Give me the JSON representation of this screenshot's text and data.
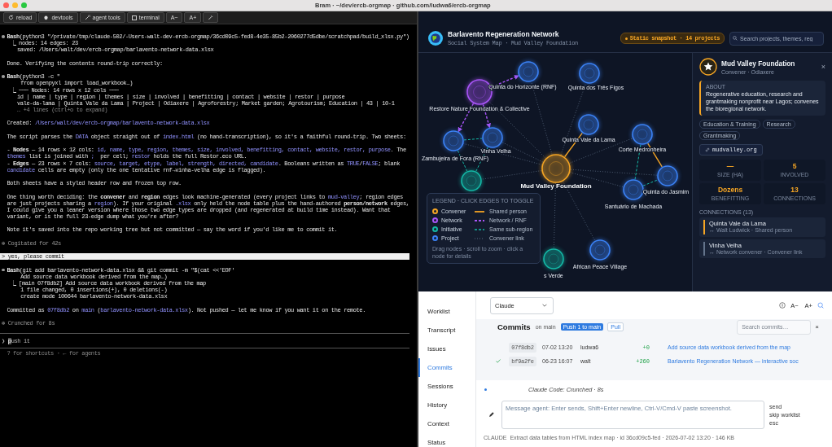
{
  "window": {
    "title": "Bram · ~/dev/ercb-orgmap · github.com/ludwa6/ercb-orgmap"
  },
  "toolbar": [
    {
      "kind": "button",
      "label": "reload"
    },
    {
      "kind": "button",
      "label": "devtools"
    },
    {
      "kind": "button",
      "label": "agent tools"
    },
    {
      "kind": "toggle",
      "label": "terminal",
      "checked": false
    },
    {
      "kind": "button",
      "label": "A−"
    },
    {
      "kind": "button",
      "label": "A+"
    }
  ],
  "terminal": {
    "blocks": [
      {
        "lines": [
          {
            "kind": "tool",
            "parts": [
              {
                "text": "Bash",
                "kind": "bold"
              },
              "(python3 \"/private/tmp/claude-502/-Users-walt-dev-ercb-orgmap/36cd09c5-fed8-4e35-85b2-2060277d5dbe/scratchpad/build_xlsx.py\")"
            ]
          },
          {
            "kind": "result",
            "parts": [
              "⎿ nodes: 14 edges: 23"
            ]
          },
          {
            "kind": "cont",
            "parts": [
              "saved: /Users/walt/dev/ercb-orgmap/barlavento-network-data.xlsx"
            ]
          }
        ]
      },
      {
        "lines": [
          {
            "kind": "text",
            "parts": [
              "Done. Verifying the contents round-trip correctly:"
            ]
          }
        ]
      },
      {
        "lines": [
          {
            "kind": "tool",
            "parts": [
              {
                "text": "Bash",
                "kind": "bold"
              },
              "(python3 -c \""
            ]
          },
          {
            "kind": "arg",
            "parts": [
              "from openpyxl import load_workbook…)"
            ]
          },
          {
            "kind": "result",
            "parts": [
              "⎿ ─── Nodes: 14 rows x 12 cols ───"
            ]
          },
          {
            "kind": "cont",
            "parts": [
              "id | name | type | region | themes | size | involved | benefitting | contact | website | restor | purpose"
            ]
          },
          {
            "kind": "cont",
            "parts": [
              "vale-da-lama | Quinta Vale da Lama | Project | Odiaxere | Agroforestry; Market garden; Agrotourism; Education | 43 | 10-1"
            ]
          },
          {
            "kind": "dim",
            "parts": [
              "… +4 lines (ctrl+o to expand)"
            ]
          }
        ]
      },
      {
        "lines": [
          {
            "kind": "text",
            "parts": [
              "Created: ",
              {
                "text": "/Users/walt/dev/ercb-orgmap/barlavento-network-data.xlsx",
                "kind": "code"
              }
            ]
          }
        ]
      },
      {
        "lines": [
          {
            "kind": "text",
            "parts": [
              "The script parses the ",
              {
                "text": "DATA",
                "kind": "code"
              },
              " object straight out of ",
              {
                "text": "index.html",
                "kind": "code"
              },
              " (no hand-transcription), so it's a faithful round-trip. Two sheets:"
            ]
          }
        ]
      },
      {
        "lines": [
          {
            "kind": "text",
            "parts": [
              "- ",
              {
                "text": "Nodes",
                "kind": "bold"
              },
              " — 14 rows × 12 cols: ",
              {
                "text": "id, name, type, region, themes, size, involved, benefitting, contact, website, restor, purpose",
                "kind": "code"
              },
              ". The"
            ]
          },
          {
            "kind": "text",
            "parts": [
              {
                "text": "themes",
                "kind": "code"
              },
              " list is joined with ",
              {
                "text": ";",
                "kind": "code"
              },
              "  per cell; ",
              {
                "text": "restor",
                "kind": "code"
              },
              " holds the full Restor.eco URL."
            ]
          },
          {
            "kind": "text",
            "parts": [
              "- ",
              {
                "text": "Edges",
                "kind": "bold"
              },
              " — 23 rows × 7 cols: ",
              {
                "text": "source, target, etype, label, strength, directed, candidate",
                "kind": "code"
              },
              ". Booleans written as ",
              {
                "text": "TRUE",
                "kind": "code"
              },
              "/",
              {
                "text": "FALSE",
                "kind": "code"
              },
              "; blank"
            ]
          },
          {
            "kind": "text",
            "parts": [
              {
                "text": "candidate",
                "kind": "code"
              },
              " cells are empty (only the one tentative rnf→vinha-velha edge is flagged)."
            ]
          }
        ]
      },
      {
        "lines": [
          {
            "kind": "text",
            "parts": [
              "Both sheets have a styled header row and frozen top row."
            ]
          }
        ]
      },
      {
        "lines": [
          {
            "kind": "text",
            "parts": [
              "One thing worth deciding: the ",
              {
                "text": "convener",
                "kind": "bold"
              },
              " and ",
              {
                "text": "region",
                "kind": "bold"
              },
              " edges look machine-generated (every project links to ",
              {
                "text": "mud-valley",
                "kind": "code"
              },
              "; region edges"
            ]
          },
          {
            "kind": "text",
            "parts": [
              "are just projects sharing a ",
              {
                "text": "region",
                "kind": "code"
              },
              "). If your original ",
              {
                "text": ".xlsx",
                "kind": "code"
              },
              " only held the node table plus the hand-authored ",
              {
                "text": "person/network",
                "kind": "bold"
              },
              " edges,"
            ]
          },
          {
            "kind": "text",
            "parts": [
              "I could give you a leaner version where those two edge types are dropped (and regenerated at build time instead). Want that"
            ]
          },
          {
            "kind": "text",
            "parts": [
              "variant, or is the full 23-edge dump what you're after?"
            ]
          }
        ]
      },
      {
        "lines": [
          {
            "kind": "text",
            "parts": [
              "Note it's saved into the repo working tree but not committed — say the word if you'd like me to commit it."
            ]
          }
        ]
      },
      {
        "lines": [
          {
            "kind": "status",
            "parts": [
              "✻ Cogitated for 42s"
            ]
          }
        ]
      },
      {
        "lines": [
          {
            "kind": "prompt",
            "parts": [
              "> yes, please commit"
            ]
          }
        ]
      },
      {
        "lines": [
          {
            "kind": "tool",
            "parts": [
              {
                "text": "Bash",
                "kind": "bold"
              },
              "(git add barlavento-network-data.xlsx && git commit -m \"$(cat <<'EOF'"
            ]
          },
          {
            "kind": "arg",
            "parts": [
              "Add source data workbook derived from the map…)"
            ]
          },
          {
            "kind": "result",
            "parts": [
              "⎿ [main 07f8db2] Add source data workbook derived from the map"
            ]
          },
          {
            "kind": "arg",
            "parts": [
              "1 file changed, 0 insertions(+), 0 deletions(-)"
            ]
          },
          {
            "kind": "arg",
            "parts": [
              "create mode 100644 barlavento-network-data.xlsx"
            ]
          }
        ]
      },
      {
        "lines": [
          {
            "kind": "text",
            "parts": [
              "Committed as ",
              {
                "text": "07f8db2",
                "kind": "code"
              },
              " on ",
              {
                "text": "main",
                "kind": "code"
              },
              " (",
              {
                "text": "barlavento-network-data.xlsx",
                "kind": "code"
              },
              "). Not pushed — let me know if you want it on the remote."
            ]
          }
        ]
      },
      {
        "lines": [
          {
            "kind": "status",
            "parts": [
              "✻ Crunched for 8s"
            ]
          }
        ]
      }
    ],
    "input": {
      "prompt": "❯",
      "value": "push it"
    },
    "hint": "? for shortcuts · ← for agents"
  },
  "map": {
    "title": "Barlavento Regeneration Network",
    "subtitle": "Social System Map · Mud Valley Foundation",
    "badge": "Static snapshot · 14 projects",
    "search": {
      "placeholder": "Search projects, themes, reg"
    },
    "nodes": [
      {
        "label": "Mud Valley Foundation",
        "kind": "convener"
      },
      {
        "label": "Restore Nature Foundation & Collective",
        "kind": "network"
      },
      {
        "label": "Quinta do Horizonte (RNF)",
        "kind": "project"
      },
      {
        "label": "Quinta dos Três Figos",
        "kind": "project"
      },
      {
        "label": "Quinta Vale da Lama",
        "kind": "project"
      },
      {
        "label": "Corte Medronheira",
        "kind": "project"
      },
      {
        "label": "Zambujeira de Fora (RNF)",
        "kind": "project"
      },
      {
        "label": "Vinha Velha",
        "kind": "project"
      },
      {
        "label": "Quinta do Jasmim",
        "kind": "project"
      },
      {
        "label": "Santuário de Machada",
        "kind": "project"
      },
      {
        "kind": "initiative"
      },
      {
        "label": "s Verde",
        "kind": "initiative"
      },
      {
        "label": "African Peace Village",
        "kind": "project"
      }
    ],
    "legend": {
      "title": "LEGEND · CLICK EDGES TO TOGGLE",
      "node_types": [
        {
          "label": "Convener",
          "color": "#f5a524"
        },
        {
          "label": "Network",
          "color": "#a855f7"
        },
        {
          "label": "Initiative",
          "color": "#14b8a6"
        },
        {
          "label": "Project",
          "color": "#3b82f6"
        }
      ],
      "edge_types": [
        {
          "label": "Shared person",
          "kind": "shared"
        },
        {
          "label": "Network / RNF",
          "kind": "network"
        },
        {
          "label": "Same sub-region",
          "kind": "region"
        },
        {
          "label": "Convener link",
          "kind": "convener"
        }
      ],
      "footer": "Drag nodes · scroll to zoom · click a node for details"
    }
  },
  "details": {
    "title": "Mud Valley Foundation",
    "subtitle": "Convener · Odiaxere",
    "close": "×",
    "about_label": "ABOUT",
    "about": "Regenerative education, research and grantmaking nonprofit near Lagos; convenes the bioregional network.",
    "tags": [
      "Education & Training",
      "Research",
      "Grantmaking"
    ],
    "link": "mudvalley.org",
    "stats": [
      {
        "value": "—",
        "label": "SIZE (HA)"
      },
      {
        "value": "5",
        "label": "INVOLVED"
      },
      {
        "value": "Dozens",
        "label": "BENEFITTING"
      },
      {
        "value": "13",
        "label": "CONNECTIONS"
      }
    ],
    "connections_title": "CONNECTIONS (13)",
    "connections": [
      {
        "name": "Quinta Vale da Lama",
        "detail": "↔ Walt Ludwick · Shared person",
        "kind": "shared"
      },
      {
        "name": "Vinha Velha",
        "detail": "↔ Network convener · Convener link",
        "kind": "convener"
      }
    ]
  },
  "workbench": {
    "nav": [
      {
        "label": "Worklist",
        "selected": false
      },
      {
        "label": "Transcript",
        "selected": false
      },
      {
        "label": "Issues",
        "selected": false
      },
      {
        "label": "Commits",
        "selected": true
      },
      {
        "label": "Sessions",
        "selected": false
      },
      {
        "label": "History",
        "selected": false
      },
      {
        "label": "Context",
        "selected": false
      },
      {
        "label": "Status",
        "selected": false
      }
    ],
    "agent": "Claude",
    "font_buttons": [
      "A−",
      "A+"
    ],
    "commits": {
      "title": "Commits",
      "branch": "on main",
      "push": "Push 1 to main",
      "pull": "Pull",
      "search": {
        "placeholder": "Search commits…"
      },
      "clear": "×",
      "rows": [
        {
          "hash": "07f8db2",
          "date": "07-02 13:20",
          "author": "ludwa6",
          "diff": "+0",
          "message": "Add source data workbook derived from the map",
          "verified": false
        },
        {
          "hash": "bf9a2fe",
          "date": "06-23 16:07",
          "author": "walt",
          "diff": "+260",
          "message": "Barlavento Regeneration Network — interactive soc",
          "verified": true
        }
      ]
    },
    "status": "Claude Code: Crunched · 8s",
    "composer": {
      "placeholder": "Message agent: Enter sends, Shift+Enter newline, Ctrl-V/Cmd-V paste screenshot.",
      "hints": [
        "send",
        "skip worklist",
        "esc"
      ]
    },
    "footer": {
      "agent": "CLAUDE",
      "summary": "Extract data tables from HTML index map · id 36cd09c5-fed · 2026-07-02 13:20 · 146 KB"
    }
  }
}
